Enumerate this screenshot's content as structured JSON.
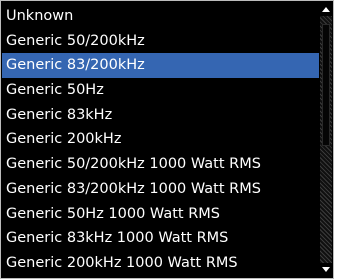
{
  "list": {
    "selected_index": 2,
    "items": [
      {
        "label": "Unknown"
      },
      {
        "label": "Generic 50/200kHz"
      },
      {
        "label": "Generic 83/200kHz"
      },
      {
        "label": "Generic 50Hz"
      },
      {
        "label": "Generic 83kHz"
      },
      {
        "label": "Generic 200kHz"
      },
      {
        "label": "Generic 50/200kHz 1000 Watt RMS"
      },
      {
        "label": "Generic 83/200kHz 1000 Watt RMS"
      },
      {
        "label": "Generic 50Hz 1000 Watt RMS"
      },
      {
        "label": "Generic 83kHz 1000 Watt RMS"
      },
      {
        "label": "Generic 200kHz 1000 Watt RMS"
      }
    ]
  },
  "scrollbar": {
    "up_icon": "arrow-up-icon",
    "down_icon": "arrow-down-icon"
  },
  "colors": {
    "background": "#000000",
    "text": "#ffffff",
    "selection": "#3566b2",
    "border": "#bcbcbc"
  }
}
